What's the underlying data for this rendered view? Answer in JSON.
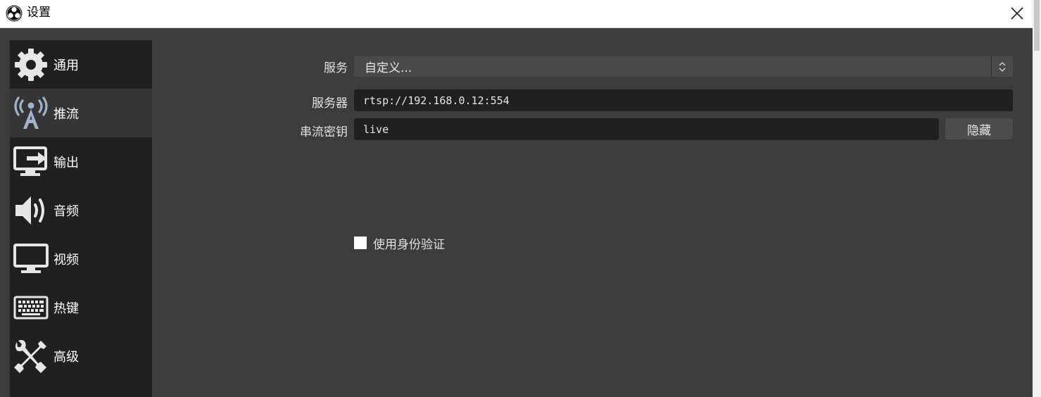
{
  "window": {
    "title": "设置",
    "close_icon": "close-icon"
  },
  "sidebar": {
    "items": [
      {
        "label": "通用",
        "icon": "gear-icon",
        "active": false
      },
      {
        "label": "推流",
        "icon": "broadcast-antenna-icon",
        "active": true
      },
      {
        "label": "输出",
        "icon": "output-monitor-icon",
        "active": false
      },
      {
        "label": "音频",
        "icon": "speaker-icon",
        "active": false
      },
      {
        "label": "视频",
        "icon": "monitor-icon",
        "active": false
      },
      {
        "label": "热键",
        "icon": "keyboard-icon",
        "active": false
      },
      {
        "label": "高级",
        "icon": "wrench-screwdriver-icon",
        "active": false
      }
    ]
  },
  "stream": {
    "service_label": "服务",
    "service_value": "自定义...",
    "server_label": "服务器",
    "server_value": "rtsp://192.168.0.12:554",
    "key_label": "串流密钥",
    "key_value": "live",
    "hide_button": "隐藏",
    "auth_label": "使用身份验证",
    "auth_checked": false
  },
  "colors": {
    "background": "#3c3c3c",
    "sidebar": "#202020",
    "sidebar_active": "#353535",
    "accent_icon": "#9fb4cc"
  }
}
